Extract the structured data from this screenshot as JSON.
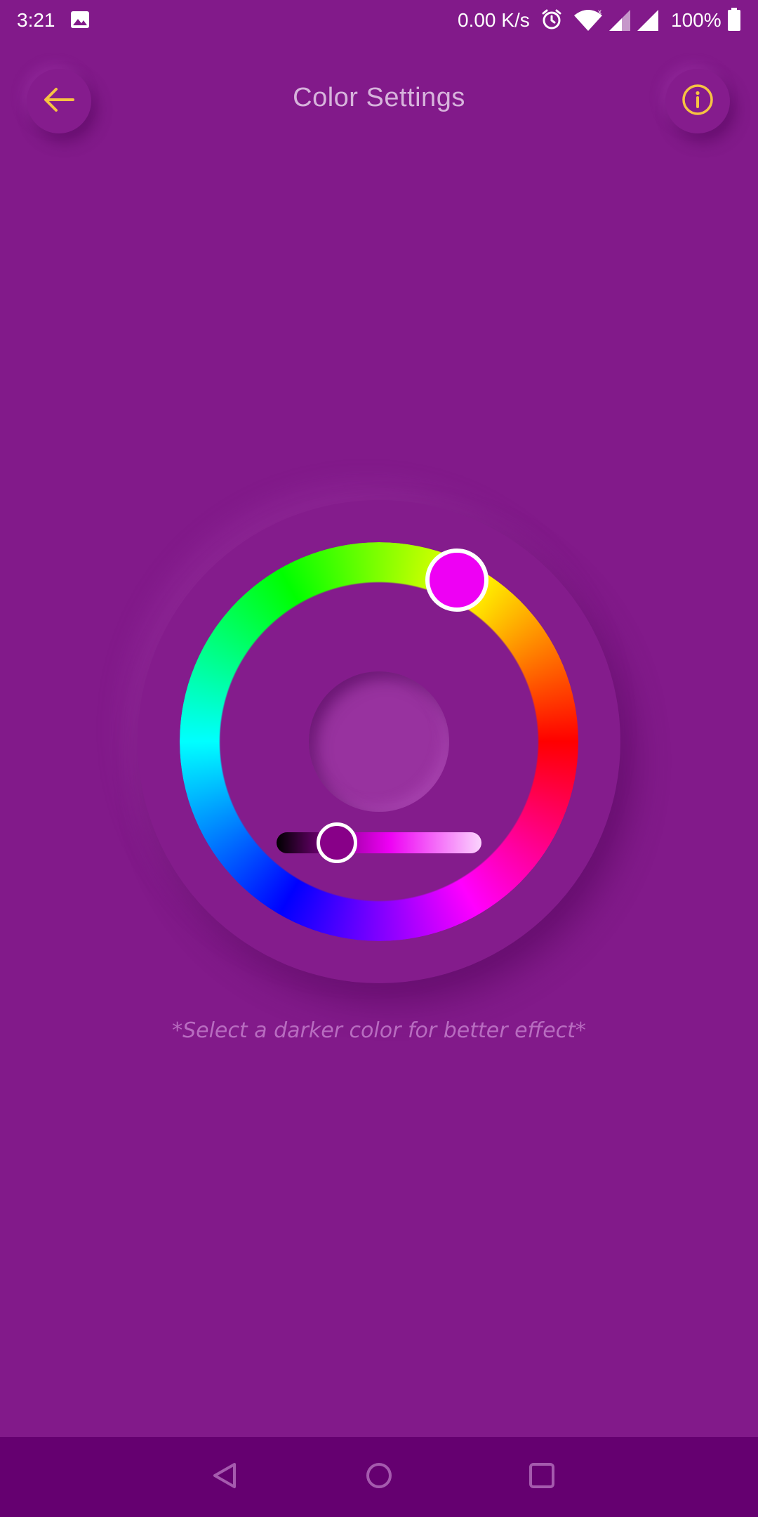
{
  "status_bar": {
    "time": "3:21",
    "net_speed": "0.00 K/s",
    "battery": "100%",
    "icons": [
      "gallery-icon",
      "alarm-icon",
      "wifi-icon",
      "signal-icon",
      "battery-icon"
    ]
  },
  "header": {
    "title": "Color Settings",
    "back_icon": "arrow-left-icon",
    "info_icon": "info-icon"
  },
  "picker": {
    "selected_hue_color": "#ee00f4",
    "brightness_level": 0.28,
    "preview_color": "#98329f"
  },
  "hint": "*Select a darker color for better effect*",
  "colors": {
    "background": "#821a8a",
    "accent": "#f6c342",
    "title": "#d7b4dc",
    "nav_bar": "#650070"
  },
  "nav_bar": {
    "icons": [
      "back-triangle-icon",
      "home-circle-icon",
      "recents-square-icon"
    ]
  }
}
